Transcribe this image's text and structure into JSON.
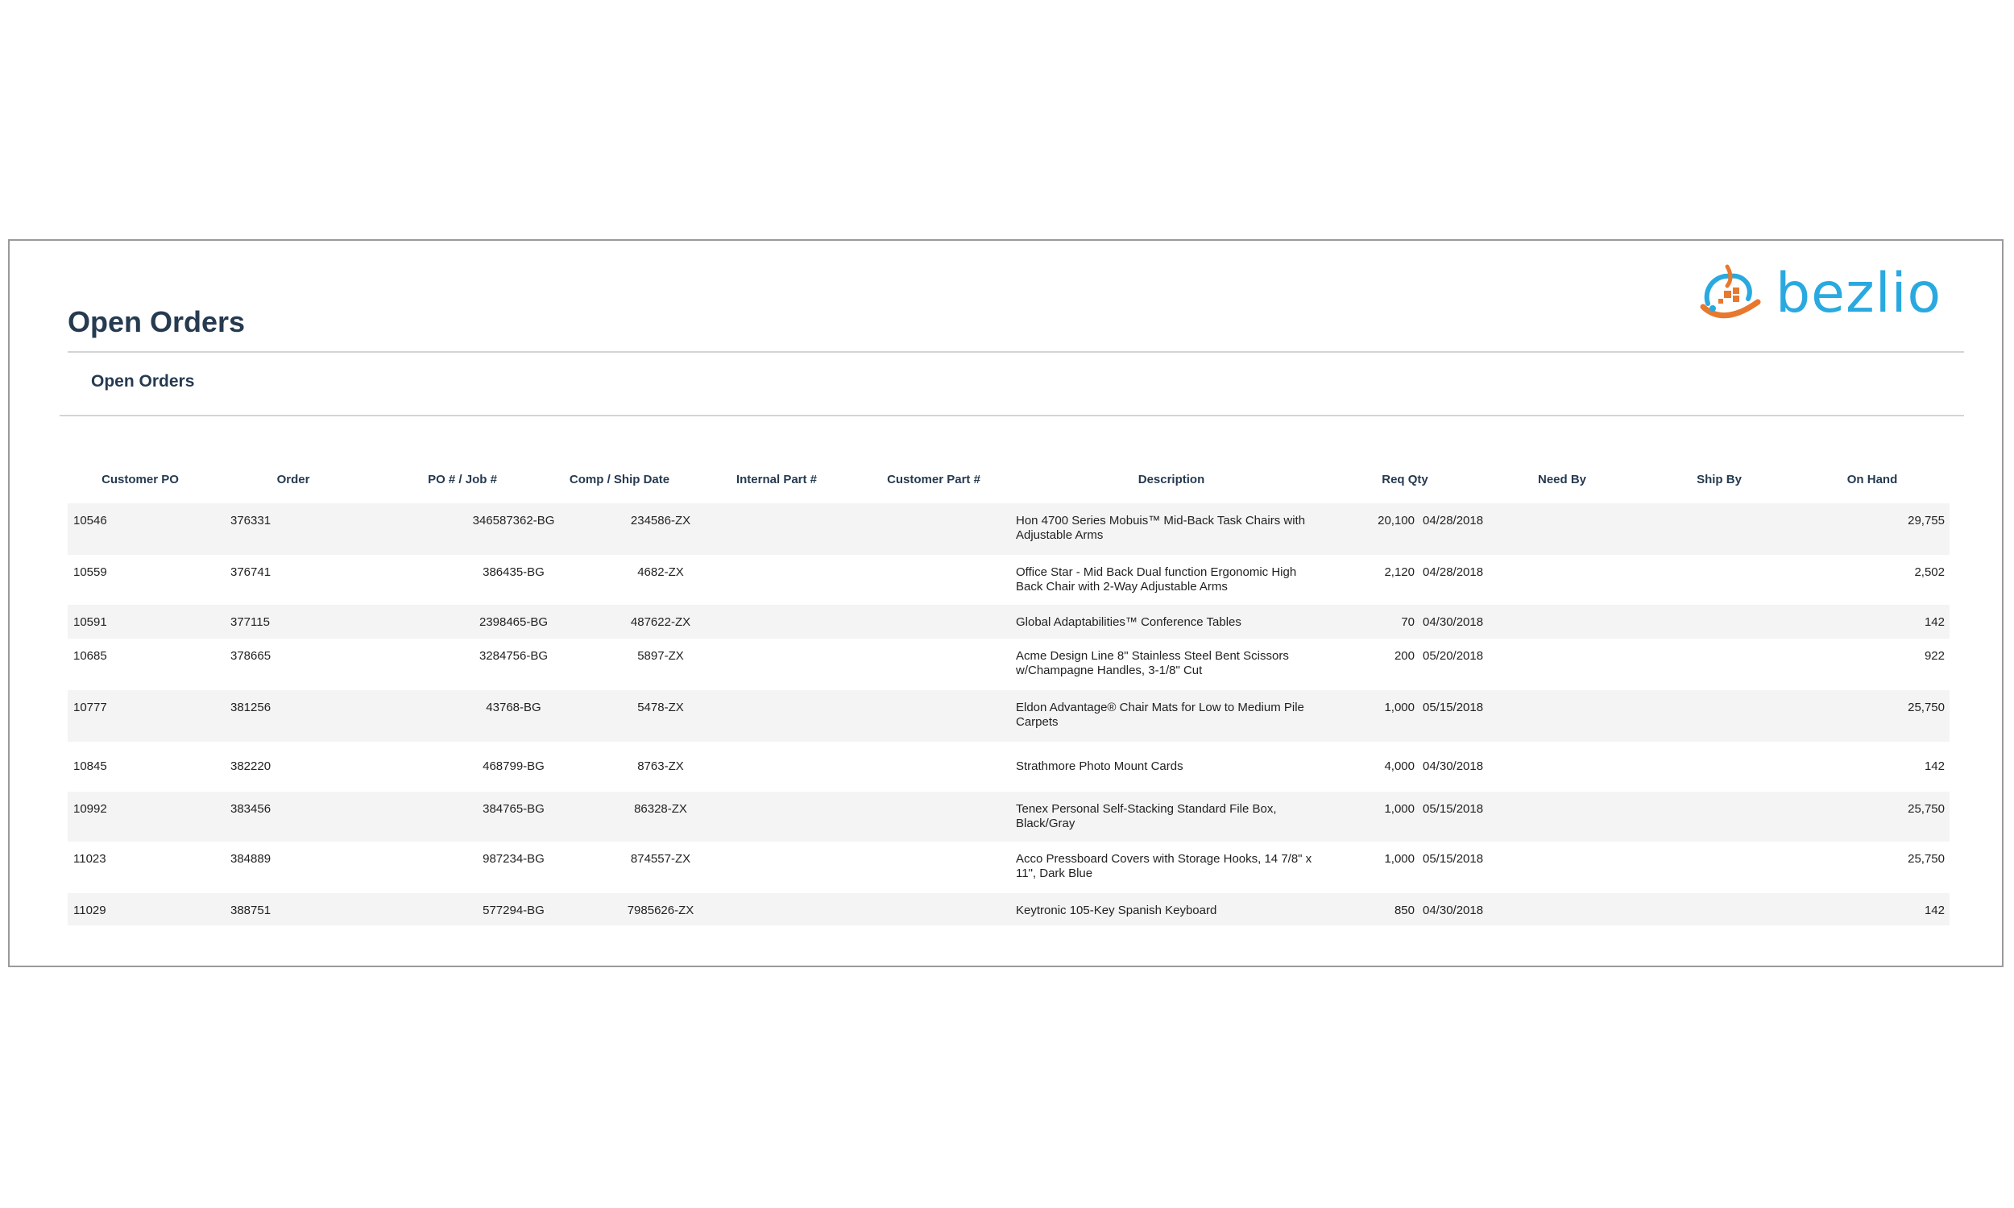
{
  "brand": {
    "name": "bezlio",
    "colors": {
      "orange": "#e8782e",
      "blue": "#29a9e0"
    }
  },
  "page_title": "Open Orders",
  "section_title": "Open Orders",
  "columns": [
    "Customer PO",
    "Order",
    "PO # / Job #",
    "Comp / Ship Date",
    "Internal Part #",
    "Customer Part #",
    "Description",
    "Req Qty",
    "Need By",
    "Ship By",
    "On Hand"
  ],
  "rows": [
    {
      "customer_po": "10546",
      "order": "376331",
      "po_job": "",
      "comp_ship_date": "",
      "internal_part": "346587362-BG",
      "customer_part": "234586-ZX",
      "description": "Hon 4700 Series Mobuis™ Mid-Back Task Chairs with Adjustable Arms",
      "req_qty": "20,100",
      "need_by": "04/28/2018",
      "ship_by": "",
      "on_hand": "29,755"
    },
    {
      "customer_po": "10559",
      "order": "376741",
      "po_job": "",
      "comp_ship_date": "",
      "internal_part": "386435-BG",
      "customer_part": "4682-ZX",
      "description": "Office Star - Mid Back Dual function Ergonomic High Back Chair with 2-Way Adjustable Arms",
      "req_qty": "2,120",
      "need_by": "04/28/2018",
      "ship_by": "",
      "on_hand": "2,502"
    },
    {
      "customer_po": "10591",
      "order": "377115",
      "po_job": "",
      "comp_ship_date": "",
      "internal_part": "2398465-BG",
      "customer_part": "487622-ZX",
      "description": "Global Adaptabilities™ Conference Tables",
      "req_qty": "70",
      "need_by": "04/30/2018",
      "ship_by": "",
      "on_hand": "142"
    },
    {
      "customer_po": "10685",
      "order": "378665",
      "po_job": "",
      "comp_ship_date": "",
      "internal_part": "3284756-BG",
      "customer_part": "5897-ZX",
      "description": "Acme Design Line 8\" Stainless Steel Bent Scissors w/Champagne Handles, 3-1/8\" Cut",
      "req_qty": "200",
      "need_by": "05/20/2018",
      "ship_by": "",
      "on_hand": "922"
    },
    {
      "customer_po": "10777",
      "order": "381256",
      "po_job": "",
      "comp_ship_date": "",
      "internal_part": "43768-BG",
      "customer_part": "5478-ZX",
      "description": "Eldon Advantage® Chair Mats for Low to Medium Pile Carpets",
      "req_qty": "1,000",
      "need_by": "05/15/2018",
      "ship_by": "",
      "on_hand": "25,750"
    },
    {
      "customer_po": "10845",
      "order": "382220",
      "po_job": "",
      "comp_ship_date": "",
      "internal_part": "468799-BG",
      "customer_part": "8763-ZX",
      "description": "Strathmore Photo Mount Cards",
      "req_qty": "4,000",
      "need_by": "04/30/2018",
      "ship_by": "",
      "on_hand": "142"
    },
    {
      "customer_po": "10992",
      "order": "383456",
      "po_job": "",
      "comp_ship_date": "",
      "internal_part": "384765-BG",
      "customer_part": "86328-ZX",
      "description": "Tenex Personal Self-Stacking Standard File Box, Black/Gray",
      "req_qty": "1,000",
      "need_by": "05/15/2018",
      "ship_by": "",
      "on_hand": "25,750"
    },
    {
      "customer_po": "11023",
      "order": "384889",
      "po_job": "",
      "comp_ship_date": "",
      "internal_part": "987234-BG",
      "customer_part": "874557-ZX",
      "description": "Acco Pressboard Covers with Storage Hooks, 14 7/8\" x 11\", Dark Blue",
      "req_qty": "1,000",
      "need_by": "05/15/2018",
      "ship_by": "",
      "on_hand": "25,750"
    },
    {
      "customer_po": "11029",
      "order": "388751",
      "po_job": "",
      "comp_ship_date": "",
      "internal_part": "577294-BG",
      "customer_part": "7985626-ZX",
      "description": "Keytronic 105-Key Spanish Keyboard",
      "req_qty": "850",
      "need_by": "04/30/2018",
      "ship_by": "",
      "on_hand": "142"
    }
  ]
}
